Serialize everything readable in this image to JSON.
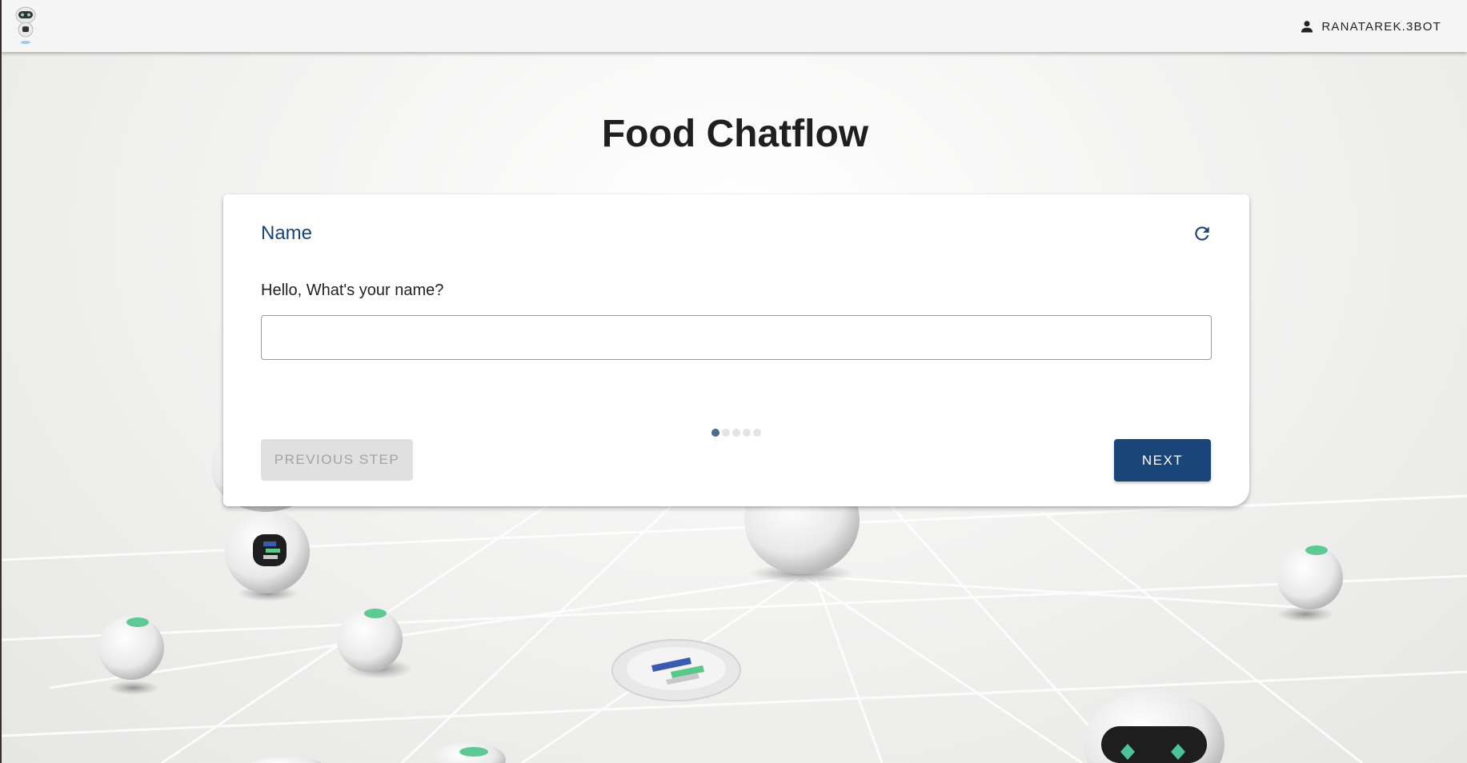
{
  "header": {
    "user_name": "RANATAREK.3BOT",
    "logo_icon": "robot-logo-icon",
    "user_icon": "person-icon"
  },
  "page": {
    "title": "Food Chatflow"
  },
  "step": {
    "title": "Name",
    "question": "Hello, What's your name?",
    "input_value": "",
    "refresh_icon": "refresh-icon",
    "total_steps": 5,
    "current_step": 1
  },
  "buttons": {
    "previous_label": "PREVIOUS STEP",
    "next_label": "NEXT"
  },
  "colors": {
    "primary": "#1a4578",
    "step_title": "#1a4578",
    "disabled_bg": "#e0e0e0",
    "disabled_text": "#a3a3a3"
  }
}
